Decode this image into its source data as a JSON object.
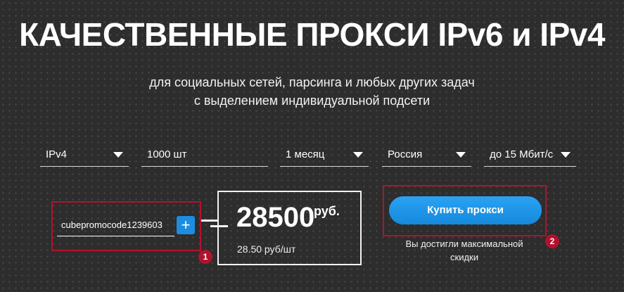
{
  "hero": {
    "title": "КАЧЕСТВЕННЫЕ ПРОКСИ IPv6 и IPv4",
    "subtitle_line1": "для социальных сетей, парсинга и любых других задач",
    "subtitle_line2": "с выделением индивидуальной подсети"
  },
  "filters": {
    "protocol": "IPv4",
    "quantity": "1000 шт",
    "period": "1 месяц",
    "country": "Россия",
    "speed": "до 15 Мбит/с"
  },
  "promo": {
    "code": "cubepromocode1239603",
    "add_label": "+"
  },
  "price": {
    "total": "28500",
    "currency": "руб.",
    "per_unit": "28.50 руб/шт"
  },
  "buy": {
    "label": "Купить прокси",
    "limit_line1": "Вы достигли максимальной",
    "limit_line2": "скидки"
  },
  "annotations": {
    "badge1": "1",
    "badge2": "2",
    "color": "#b0132e"
  },
  "colors": {
    "accent": "#1c8ddf",
    "background": "#2d2d2d"
  }
}
